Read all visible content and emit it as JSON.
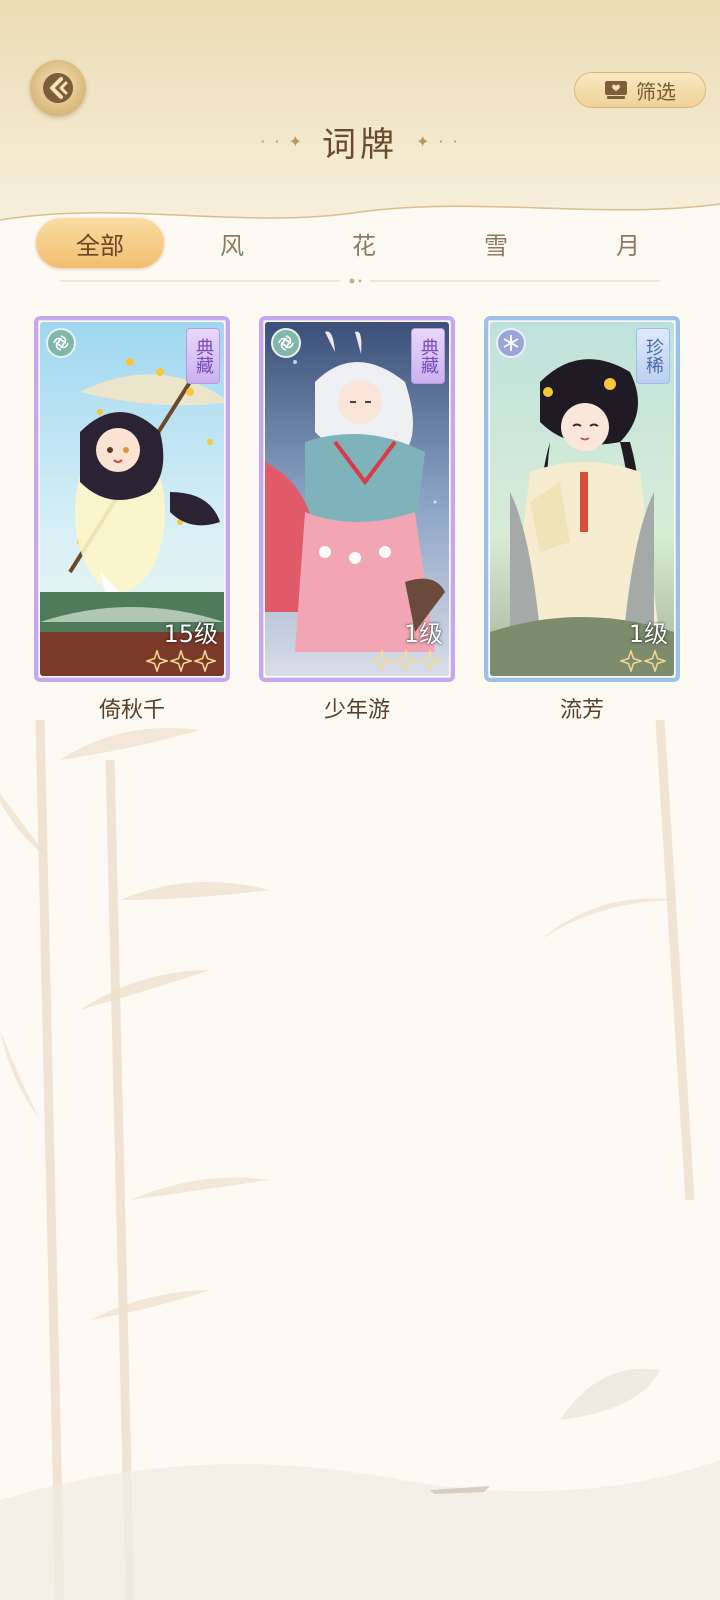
{
  "header": {
    "title": "词牌",
    "filter_label": "筛选"
  },
  "tabs": [
    {
      "label": "全部",
      "active": true
    },
    {
      "label": "风",
      "active": false
    },
    {
      "label": "花",
      "active": false
    },
    {
      "label": "雪",
      "active": false
    },
    {
      "label": "月",
      "active": false
    }
  ],
  "cards": [
    {
      "name": "倚秋千",
      "rarity": "典藏",
      "level": "15级",
      "stars_total": 3,
      "frame_color": "#b89ae0",
      "element": "wind"
    },
    {
      "name": "少年游",
      "rarity": "典藏",
      "level": "1级",
      "stars_total": 3,
      "frame_color": "#b89ae0",
      "element": "wind"
    },
    {
      "name": "流芳",
      "rarity": "珍稀",
      "level": "1级",
      "stars_total": 2,
      "frame_color": "#8fb5e0",
      "element": "snow"
    }
  ],
  "colors": {
    "accent": "#f1be70",
    "title": "#6b4a2c",
    "legendary_frame": "#b89ae0",
    "rare_frame": "#8fb5e0"
  }
}
